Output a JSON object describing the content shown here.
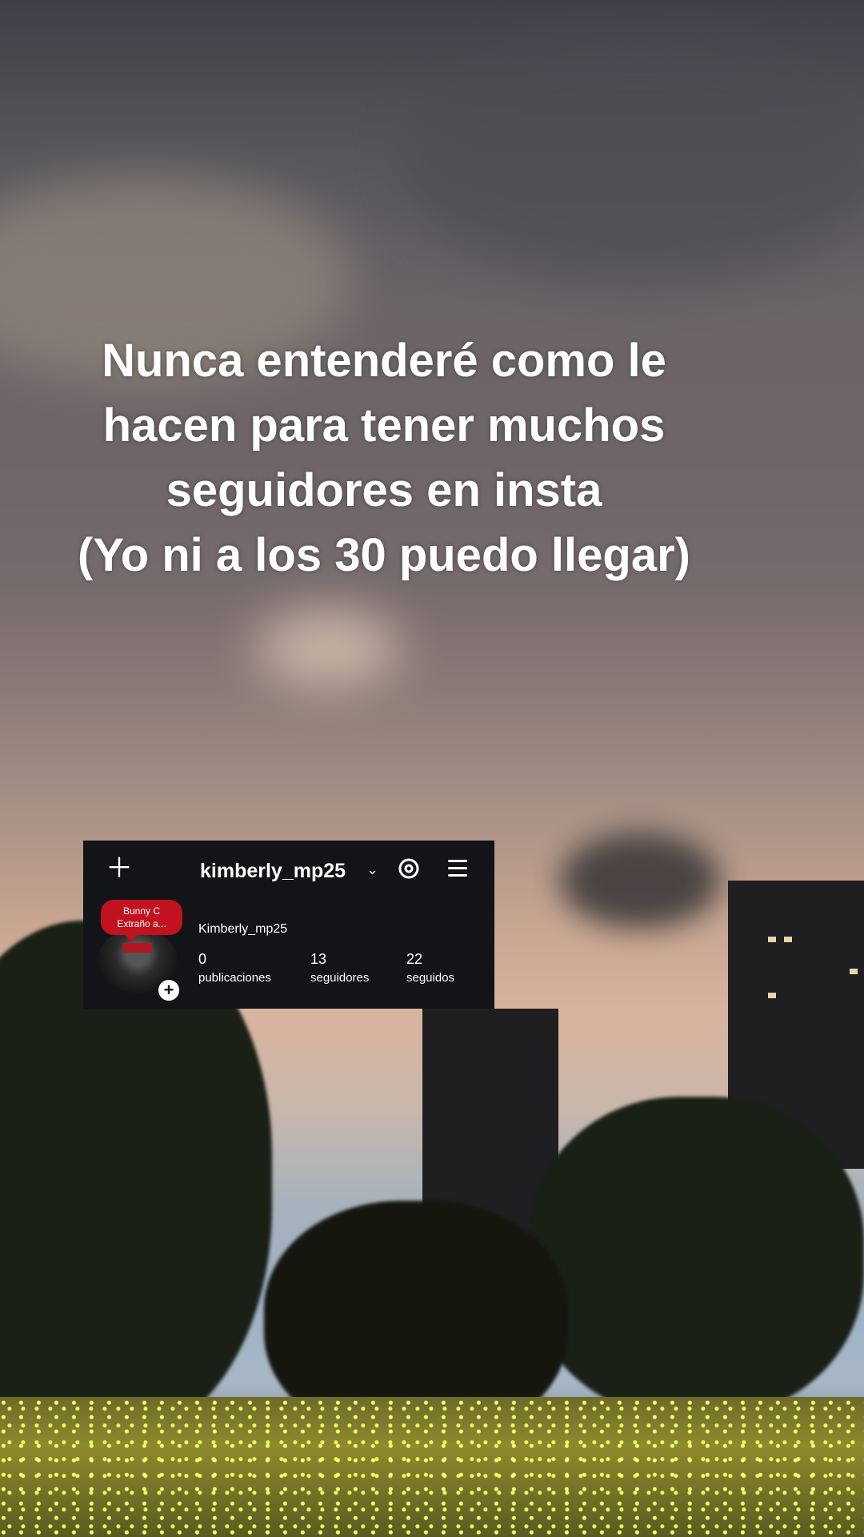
{
  "caption": {
    "lines": [
      "Nunca entenderé como le",
      "hacen para tener muchos",
      "seguidores en insta",
      "(Yo ni a los 30 puedo llegar)"
    ]
  },
  "profile_card": {
    "username": "kimberly_mp25",
    "display_name": "Kimberly_mp25",
    "note": {
      "line1": "Bunny C",
      "line2": "Extraño a..."
    },
    "stats": [
      {
        "value": "0",
        "label": "publicaciones"
      },
      {
        "value": "13",
        "label": "seguidores"
      },
      {
        "value": "22",
        "label": "seguidos"
      }
    ],
    "icons": [
      "plus-icon",
      "chevron-down-icon",
      "threads-icon",
      "menu-icon",
      "add-story-icon"
    ]
  },
  "colors": {
    "card_background": "#121417",
    "note_red": "#c1121f",
    "caption_text": "#ffffff"
  }
}
